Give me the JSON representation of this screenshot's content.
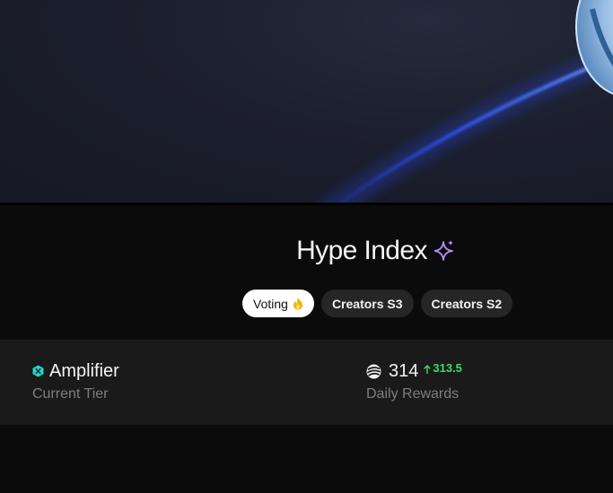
{
  "colors": {
    "accent_glow": "#2a4cff",
    "sparkle": "#b48cff",
    "tier_icon": "#26d7c8",
    "delta_positive": "#3ddc6a",
    "fire": "#f5b400"
  },
  "header": {
    "title": "Hype Index",
    "title_icon": "sparkle-icon"
  },
  "tabs": [
    {
      "label": "Voting",
      "icon": "fire-icon",
      "active": true
    },
    {
      "label": "Creators S3",
      "active": false
    },
    {
      "label": "Creators S2",
      "active": false
    }
  ],
  "stats": {
    "tier": {
      "icon": "hexagon-tier-icon",
      "value": "Amplifier",
      "label": "Current Tier"
    },
    "rewards": {
      "icon": "rewards-token-icon",
      "value": "314",
      "delta": "313.5",
      "delta_icon": "arrow-up-icon",
      "label": "Daily Rewards"
    }
  }
}
